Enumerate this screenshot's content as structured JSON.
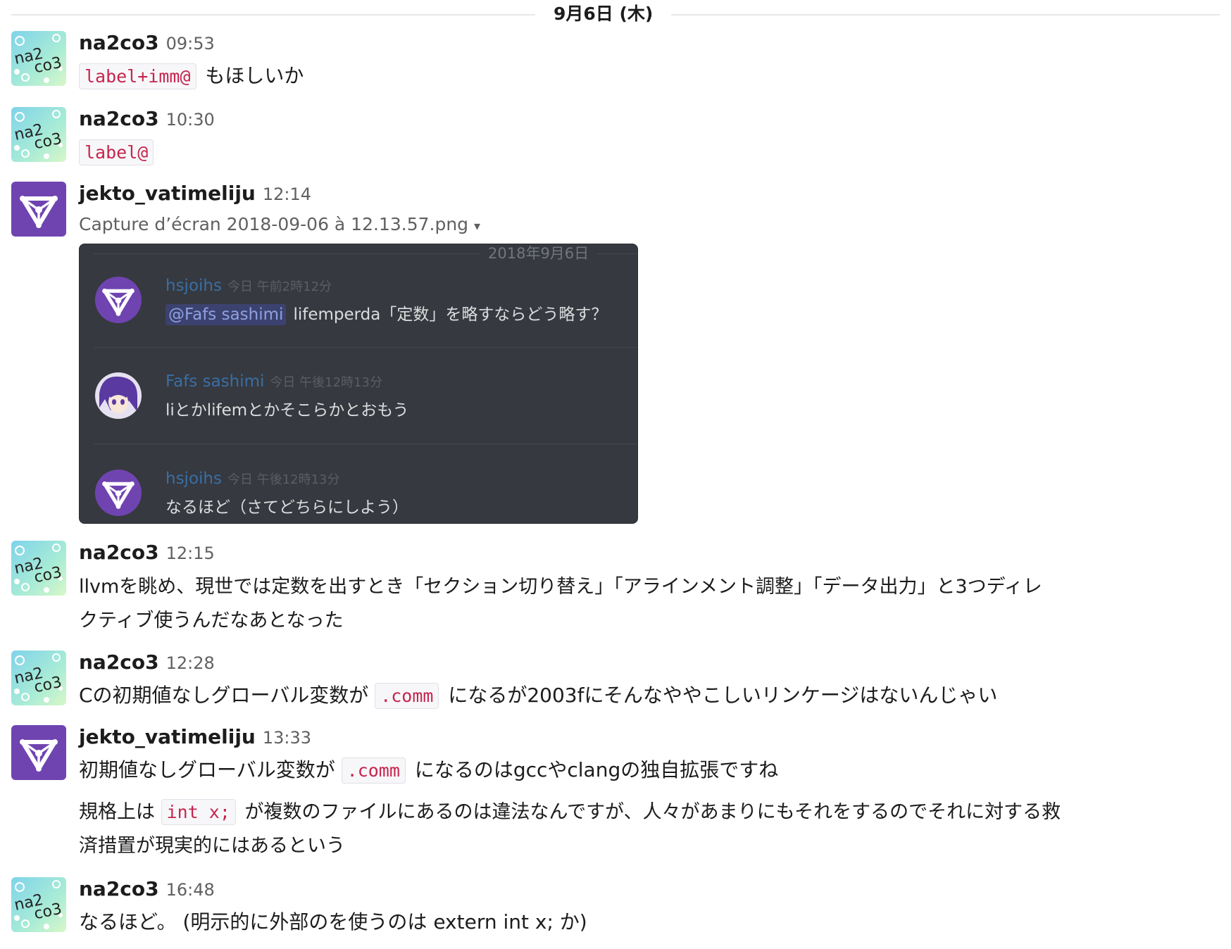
{
  "date_divider": "9月6日 (木)",
  "colors": {
    "code_text": "#c7254e",
    "discord_bg": "#36393f",
    "discord_name": "#3a6ea5",
    "mention_bg": "#3c4270",
    "jekto_avatar_bg": "#6f44b0"
  },
  "messages": [
    {
      "user": "na2co3",
      "time": "09:53",
      "code": "label+imm@",
      "text": "もほしいか"
    },
    {
      "user": "na2co3",
      "time": "10:30",
      "code": "label@"
    },
    {
      "user": "jekto_vatimeliju",
      "time": "12:14",
      "file_name": "Capture d’écran 2018-09-06 à 12.13.57.png",
      "file_caret": "▾"
    },
    {
      "user": "na2co3",
      "time": "12:15",
      "line1": "llvmを眺め、現世では定数を出すとき「セクション切り替え」「アラインメント調整」「データ出力」と3つディレ",
      "line2": "クティブ使うんだなあとなった"
    },
    {
      "user": "na2co3",
      "time": "12:28",
      "before": "Cの初期値なしグローバル変数が",
      "code": ".comm",
      "after": "になるが2003fにそんなややこしいリンケージはないんじゃい"
    },
    {
      "user": "jekto_vatimeliju",
      "time": "13:33",
      "before": "初期値なしグローバル変数が",
      "code": ".comm",
      "after": "になるのはgccやclangの独自拡張ですね",
      "p2_before": "規格上は",
      "p2_code": "int x;",
      "p2_after": "が複数のファイルにあるのは違法なんですが、人々があまりにもそれをするのでそれに対する救",
      "p2_line2": "済措置が現実的にはあるという"
    },
    {
      "user": "na2co3",
      "time": "16:48",
      "text": "なるほど。 (明示的に外部のを使うのは extern int x; か)"
    }
  ],
  "screenshot": {
    "date": "2018年9月6日",
    "messages": [
      {
        "name": "hsjoihs",
        "ts": "今日 午前2時12分",
        "mention": "@Fafs sashimi",
        "text": "lifemperda「定数」を略すならどう略す？"
      },
      {
        "name": "Fafs sashimi",
        "ts": "今日 午後12時13分",
        "text": "liとかlifemとかそこらかとおもう"
      },
      {
        "name": "hsjoihs",
        "ts": "今日 午後12時13分",
        "text": "なるほど（さてどちらにしよう）"
      }
    ]
  },
  "avatar_text": {
    "line1": "na2",
    "line2": "co3"
  }
}
